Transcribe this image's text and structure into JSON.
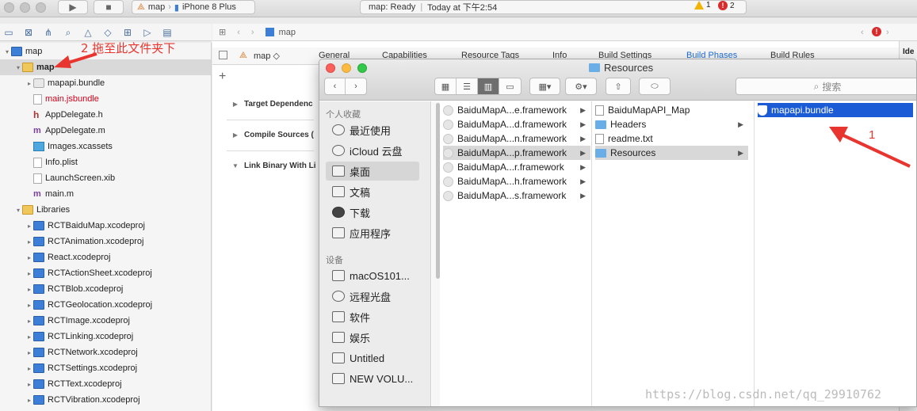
{
  "toolbar": {
    "scheme_name": "map",
    "device": "iPhone 8 Plus",
    "status_title": "map: Ready",
    "status_time": "Today at 下午2:54",
    "warnings": "1",
    "errors": "2"
  },
  "navigator": {
    "items": [
      {
        "label": "map",
        "icon": "project-icon",
        "indent": 0,
        "tri": "▾"
      },
      {
        "label": "map",
        "icon": "folder-icon",
        "indent": 1,
        "tri": "▾",
        "bold": true
      },
      {
        "label": "mapapi.bundle",
        "icon": "bundle-icon",
        "indent": 2,
        "tri": "▸"
      },
      {
        "label": "main.jsbundle",
        "icon": "file-icon",
        "indent": 2,
        "tri": "",
        "red": true
      },
      {
        "label": "AppDelegate.h",
        "icon": "header-icon",
        "indent": 2,
        "tri": ""
      },
      {
        "label": "AppDelegate.m",
        "icon": "source-icon",
        "indent": 2,
        "tri": ""
      },
      {
        "label": "Images.xcassets",
        "icon": "xcassets-icon",
        "indent": 2,
        "tri": ""
      },
      {
        "label": "Info.plist",
        "icon": "file-icon",
        "indent": 2,
        "tri": ""
      },
      {
        "label": "LaunchScreen.xib",
        "icon": "file-icon",
        "indent": 2,
        "tri": ""
      },
      {
        "label": "main.m",
        "icon": "source-icon",
        "indent": 2,
        "tri": ""
      },
      {
        "label": "Libraries",
        "icon": "folder-icon",
        "indent": 1,
        "tri": "▾"
      },
      {
        "label": "RCTBaiduMap.xcodeproj",
        "icon": "project-icon",
        "indent": 2,
        "tri": "▸"
      },
      {
        "label": "RCTAnimation.xcodeproj",
        "icon": "project-icon",
        "indent": 2,
        "tri": "▸"
      },
      {
        "label": "React.xcodeproj",
        "icon": "project-icon",
        "indent": 2,
        "tri": "▸"
      },
      {
        "label": "RCTActionSheet.xcodeproj",
        "icon": "project-icon",
        "indent": 2,
        "tri": "▸"
      },
      {
        "label": "RCTBlob.xcodeproj",
        "icon": "project-icon",
        "indent": 2,
        "tri": "▸"
      },
      {
        "label": "RCTGeolocation.xcodeproj",
        "icon": "project-icon",
        "indent": 2,
        "tri": "▸"
      },
      {
        "label": "RCTImage.xcodeproj",
        "icon": "project-icon",
        "indent": 2,
        "tri": "▸"
      },
      {
        "label": "RCTLinking.xcodeproj",
        "icon": "project-icon",
        "indent": 2,
        "tri": "▸"
      },
      {
        "label": "RCTNetwork.xcodeproj",
        "icon": "project-icon",
        "indent": 2,
        "tri": "▸"
      },
      {
        "label": "RCTSettings.xcodeproj",
        "icon": "project-icon",
        "indent": 2,
        "tri": "▸"
      },
      {
        "label": "RCTText.xcodeproj",
        "icon": "project-icon",
        "indent": 2,
        "tri": "▸"
      },
      {
        "label": "RCTVibration.xcodeproj",
        "icon": "project-icon",
        "indent": 2,
        "tri": "▸"
      }
    ]
  },
  "annotations": {
    "step2": "2 拖至此文件夹下",
    "step1": "1"
  },
  "editor": {
    "jump_project": "map",
    "target": "map ◇",
    "tabs": [
      "General",
      "Capabilities",
      "Resource Tags",
      "Info",
      "Build Settings",
      "Build Phases",
      "Build Rules"
    ],
    "active_tab": "Build Phases",
    "phases": [
      "Target Dependenc",
      "Compile Sources (",
      "Link Binary With Li"
    ],
    "right_label": "Ide"
  },
  "finder": {
    "title": "Resources",
    "search_placeholder": "搜索",
    "favorites_header": "个人收藏",
    "favorites": [
      "最近使用",
      "iCloud 云盘",
      "桌面",
      "文稿",
      "下载",
      "应用程序"
    ],
    "devices_header": "设备",
    "devices": [
      "macOS101...",
      "远程光盘",
      "软件",
      "娱乐",
      "Untitled",
      "NEW VOLU..."
    ],
    "col1": [
      "BaiduMapA...e.framework",
      "BaiduMapA...d.framework",
      "BaiduMapA...n.framework",
      "BaiduMapA...p.framework",
      "BaiduMapA...r.framework",
      "BaiduMapA...h.framework",
      "BaiduMapA...s.framework"
    ],
    "col2": [
      "BaiduMapAPI_Map",
      "Headers",
      "readme.txt",
      "Resources"
    ],
    "col3": [
      "mapapi.bundle"
    ]
  },
  "watermark": "https://blog.csdn.net/qq_29910762",
  "colors": {
    "accent": "#1c5bd6",
    "annotation": "#e8352f"
  }
}
